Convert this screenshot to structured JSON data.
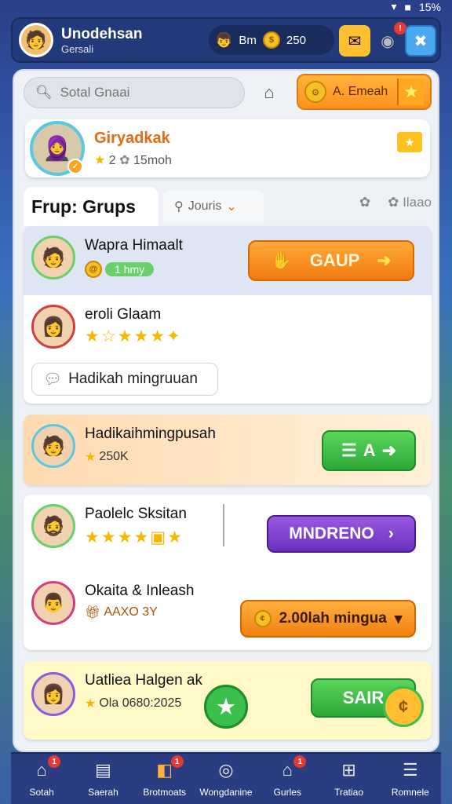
{
  "status": {
    "battery": "15%"
  },
  "topbar": {
    "title": "Unodehsan",
    "subtitle": "Gersali",
    "currency_label": "Bm",
    "coins": "250"
  },
  "search": {
    "placeholder": "Sotal Gnaai"
  },
  "event_button": {
    "label": "A. Emeah"
  },
  "profile": {
    "name": "Giryadkak",
    "stars": "2",
    "time": "15moh"
  },
  "tabs": {
    "active": "Frup: Grups",
    "journs": "Jouris",
    "right_label": "Ilaao"
  },
  "rows": [
    {
      "name": "Wapra Himaalt",
      "pill": "1 hmy",
      "button": "GAUP"
    },
    {
      "name": "eroli Glaam",
      "stars": "★☆★★★✦",
      "message": "Hadikah mingruuan"
    },
    {
      "name": "Hadikaihmingpusah",
      "sub": "250K",
      "button": "A"
    },
    {
      "name": "Paolelc Sksitan",
      "stars": "★★★★▣★",
      "button": "MNDRENO"
    },
    {
      "name": "Okaita & Inleash",
      "sub": "AAXO 3Y",
      "button": "2.00lah mingua"
    },
    {
      "name": "Uatliea Halgen ak",
      "sub": "Ola 0680:2025",
      "button": "SAIR"
    }
  ],
  "nav": [
    {
      "label": "Sotah",
      "badge": "1"
    },
    {
      "label": "Saerah",
      "badge": ""
    },
    {
      "label": "Brotmoats",
      "badge": "1"
    },
    {
      "label": "Wongdanine",
      "badge": ""
    },
    {
      "label": "Gurles",
      "badge": "1"
    },
    {
      "label": "Tratiao",
      "badge": ""
    },
    {
      "label": "Romnele",
      "badge": ""
    }
  ],
  "icons": {
    "search": "search-icon",
    "home": "home-icon",
    "star": "star-icon",
    "nav": [
      "home-icon",
      "clipboard-icon",
      "book-icon",
      "compass-icon",
      "house-icon",
      "chest-icon",
      "menu-icon"
    ]
  },
  "colors": {
    "accent_orange": "#ff9020",
    "accent_green": "#2ca83a",
    "accent_purple": "#6a30c0",
    "nav_bg": "#2a3d80"
  }
}
